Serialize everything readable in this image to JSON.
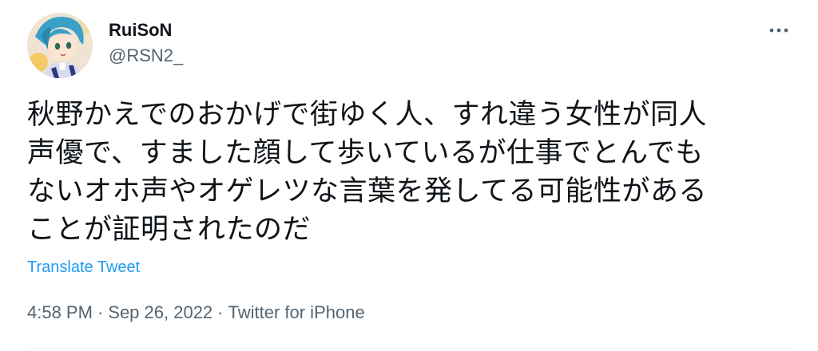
{
  "author": {
    "display_name": "RuiSoN",
    "handle": "@RSN2_"
  },
  "more_icon": "ellipsis-icon",
  "tweet": {
    "lines": [
      "秋野かえでのおかげで街ゆく人、すれ違う女性が同人",
      "声優で、すました顔して歩いているが仕事でとんでも",
      "ないオホ声やオゲレツな言葉を発してる可能性がある",
      "ことが証明されたのだ"
    ]
  },
  "translate_label": "Translate Tweet",
  "meta": {
    "time": "4:58 PM",
    "separator": "·",
    "date": "Sep 26, 2022",
    "source": "Twitter for iPhone"
  },
  "colors": {
    "text": "#0f1419",
    "secondary": "#536471",
    "link": "#1d9bf0"
  }
}
